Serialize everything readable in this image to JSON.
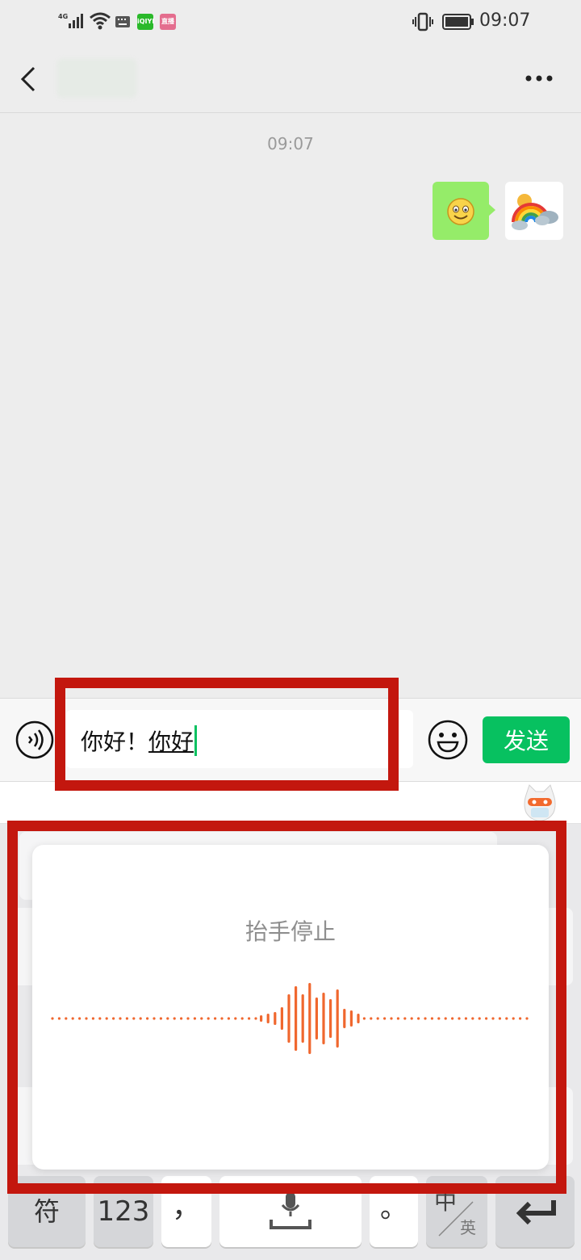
{
  "status_bar": {
    "network": "4G",
    "time": "09:07",
    "app_icon_1": "iQIYI",
    "app_icon_2": "直播"
  },
  "nav": {
    "back_icon": "chevron-left-icon",
    "more_icon": "more-dots-icon"
  },
  "chat": {
    "timestamp": "09:07",
    "messages": [
      {
        "from": "me",
        "type": "emoji",
        "content": "smile-emoji"
      }
    ]
  },
  "input": {
    "committed_text": "你好！",
    "composing_text": "你好",
    "send_label": "发送",
    "voice_icon": "voice-toggle-icon",
    "emoji_icon": "emoji-icon"
  },
  "keyboard": {
    "keys": {
      "symbols": "符",
      "numbers": "123",
      "comma": "，",
      "period": "。",
      "lang_zh": "中",
      "lang_en": "英"
    }
  },
  "voice_panel": {
    "hint": "抬手停止"
  },
  "colors": {
    "accent_green": "#07c160",
    "bubble_green": "#95ec69",
    "highlight_red": "#c3170e",
    "waveform_orange": "#f0672e"
  }
}
